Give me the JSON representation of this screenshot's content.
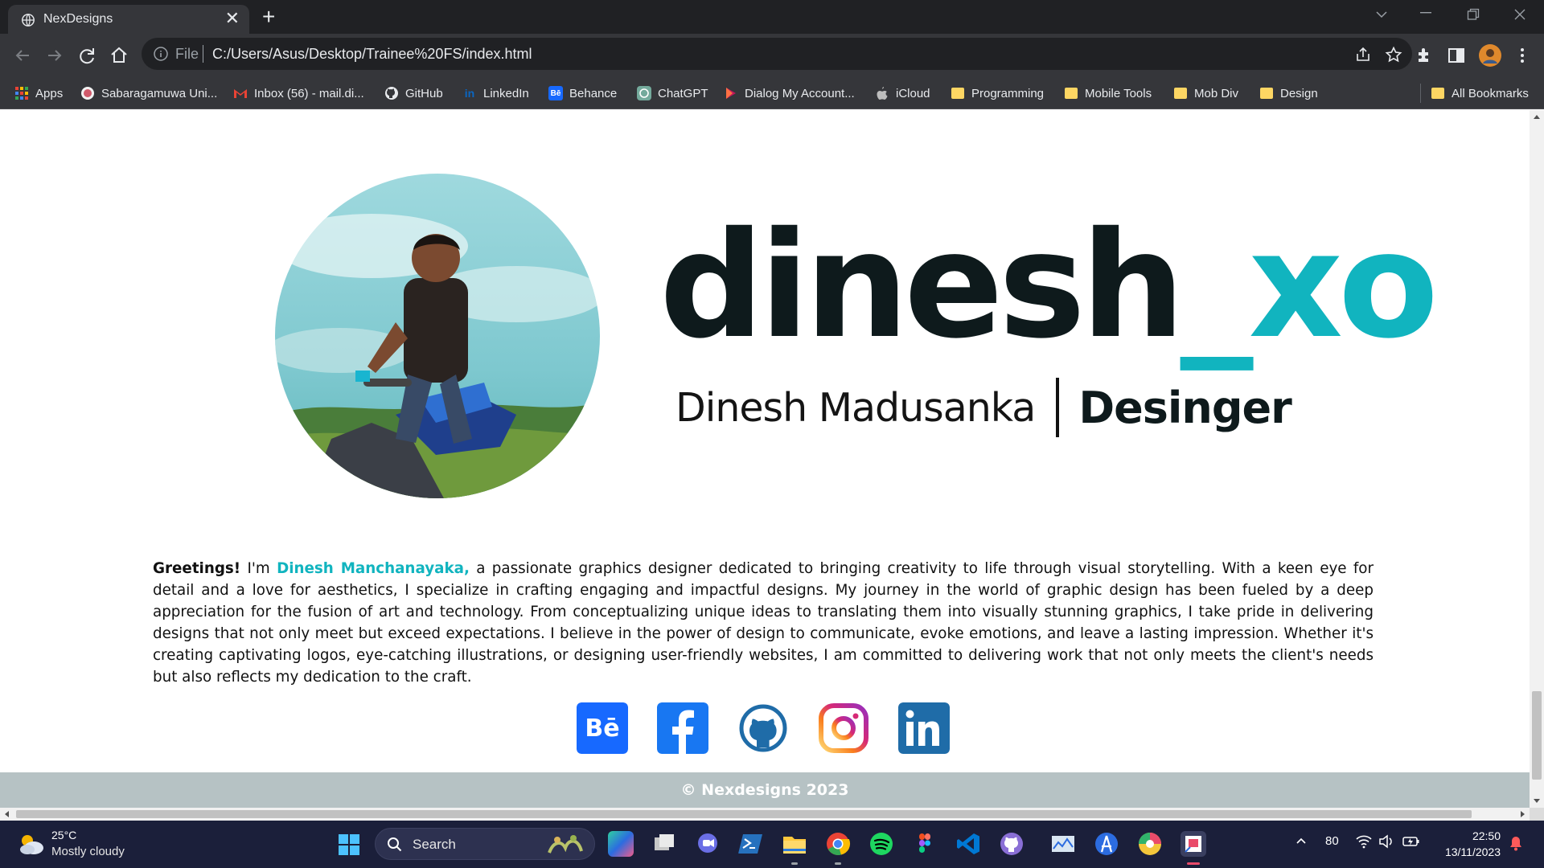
{
  "browser": {
    "tab_title": "NexDesigns",
    "tab_close": "✕",
    "new_tab": "+",
    "address_scheme": "File",
    "address_url": "C:/Users/Asus/Desktop/Trainee%20FS/index.html",
    "bookmarks": [
      {
        "label": "Apps",
        "icon": "apps-grid-icon"
      },
      {
        "label": "Sabaragamuwa Uni...",
        "icon": "university-icon"
      },
      {
        "label": "Inbox (56) - mail.di...",
        "icon": "gmail-icon"
      },
      {
        "label": "GitHub",
        "icon": "github-icon"
      },
      {
        "label": "LinkedIn",
        "icon": "linkedin-icon"
      },
      {
        "label": "Behance",
        "icon": "behance-icon"
      },
      {
        "label": "ChatGPT",
        "icon": "chatgpt-icon"
      },
      {
        "label": "Dialog My Account...",
        "icon": "dialog-icon"
      },
      {
        "label": "iCloud",
        "icon": "apple-icon"
      },
      {
        "label": "Programming",
        "icon": "folder-icon"
      },
      {
        "label": "Mobile Tools",
        "icon": "folder-icon"
      },
      {
        "label": "Mob Div",
        "icon": "folder-icon"
      },
      {
        "label": "Design",
        "icon": "folder-icon"
      },
      {
        "label": "All Bookmarks",
        "icon": "folder-icon"
      }
    ]
  },
  "page": {
    "brand_part1": "dinesh",
    "brand_part2": "_xo",
    "full_name": "Dinesh Madusanka",
    "role": "Desinger",
    "bio_greeting": "Greetings!",
    "bio_intro": " I'm ",
    "bio_name": "Dinesh Manchanayaka,",
    "bio_text": " a passionate graphics designer dedicated to bringing creativity to life through visual storytelling. With a keen eye for detail and a love for aesthetics, I specialize in crafting engaging and impactful designs. My journey in the world of graphic design has been fueled by a deep appreciation for the fusion of art and technology. From conceptualizing unique ideas to translating them into visually stunning graphics, I take pride in delivering designs that not only meet but exceed expectations. I believe in the power of design to communicate, evoke emotions, and leave a lasting impression. Whether it's creating captivating logos, eye-catching illustrations, or designing user-friendly websites, I am committed to delivering work that not only meets the client's needs but also reflects my dedication to the craft.",
    "socials": [
      "behance-icon",
      "facebook-icon",
      "github-icon",
      "instagram-icon",
      "linkedin-icon"
    ],
    "footer": "© Nexdesigns 2023",
    "colors": {
      "accent": "#11b4bf",
      "brand_dark": "#0e1a1c",
      "footer_bg": "#b6c2c4"
    }
  },
  "taskbar": {
    "weather_temp": "25°C",
    "weather_desc": "Mostly cloudy",
    "search_placeholder": "Search",
    "tray_number": "80",
    "time": "22:50",
    "date": "13/11/2023"
  }
}
